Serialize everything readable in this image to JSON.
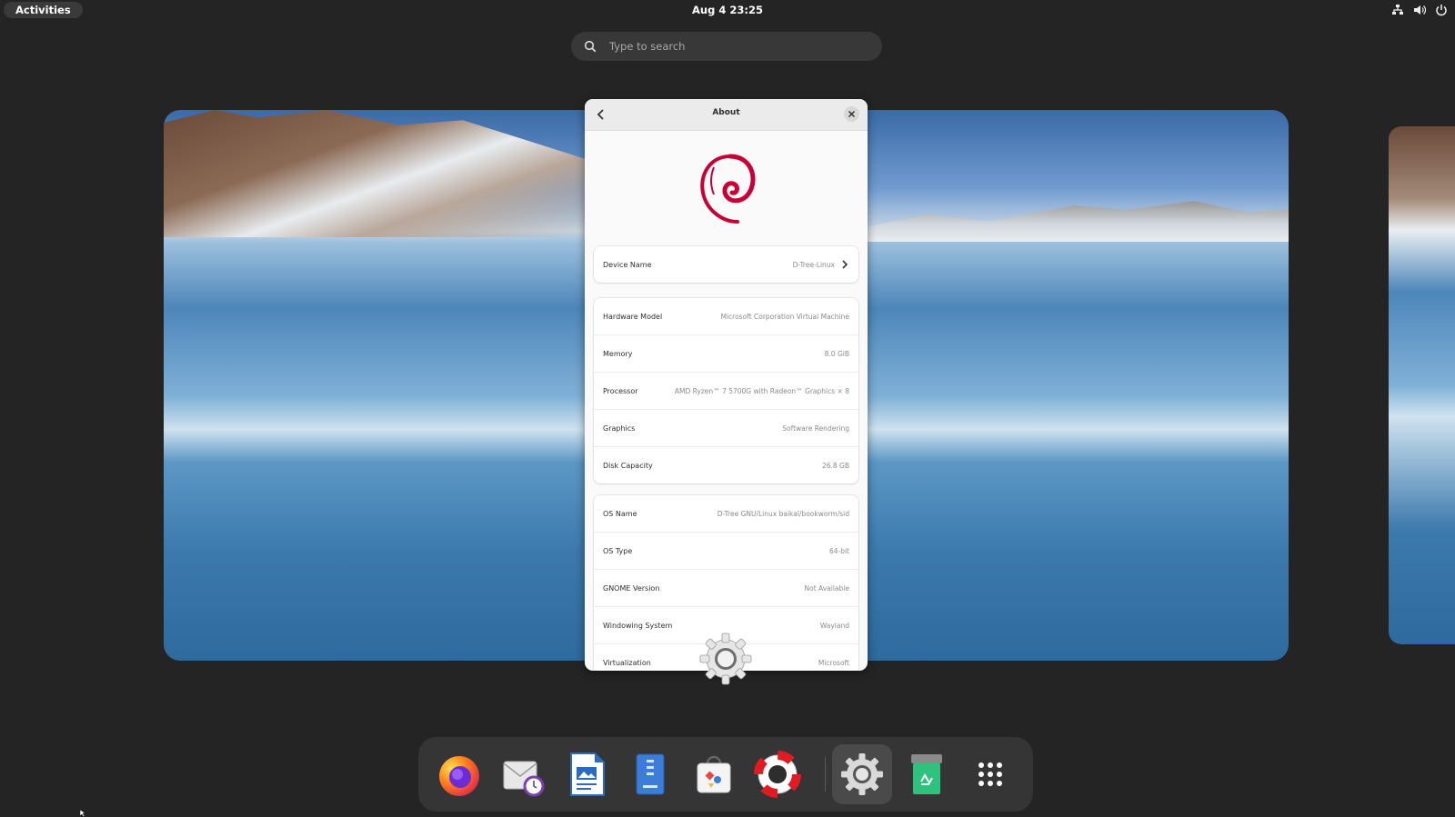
{
  "topbar": {
    "activities_label": "Activities",
    "clock": "Aug 4  23:25",
    "tray_icons": [
      "network-icon",
      "volume-icon",
      "power-icon"
    ]
  },
  "search": {
    "placeholder": "Type to search"
  },
  "about_window": {
    "title": "About",
    "device": {
      "label": "Device Name",
      "value": "D-Tree-Linux"
    },
    "hardware": [
      {
        "label": "Hardware Model",
        "value": "Microsoft Corporation Virtual Machine"
      },
      {
        "label": "Memory",
        "value": "8.0 GiB"
      },
      {
        "label": "Processor",
        "value": "AMD Ryzen™ 7 5700G with Radeon™ Graphics × 8"
      },
      {
        "label": "Graphics",
        "value": "Software Rendering"
      },
      {
        "label": "Disk Capacity",
        "value": "26.8 GB"
      }
    ],
    "software": [
      {
        "label": "OS Name",
        "value": "D-Tree GNU/Linux baikal/bookworm/sid"
      },
      {
        "label": "OS Type",
        "value": "64-bit"
      },
      {
        "label": "GNOME Version",
        "value": "Not Available"
      },
      {
        "label": "Windowing System",
        "value": "Wayland"
      },
      {
        "label": "Virtualization",
        "value": "Microsoft"
      }
    ]
  },
  "dock": {
    "apps": [
      "firefox-icon",
      "evolution-mail-icon",
      "libreoffice-impress-icon",
      "file-archiver-icon",
      "software-store-icon",
      "help-icon",
      "settings-icon",
      "trash-icon",
      "show-apps-icon"
    ],
    "active_app": "settings-icon"
  },
  "colors": {
    "shell_bg": "#242424",
    "dock_bg": "#353535",
    "window_bg": "#fafafa",
    "debian_red": "#c70036"
  }
}
